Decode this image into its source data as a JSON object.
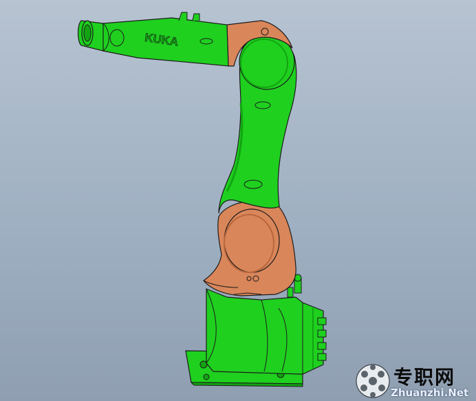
{
  "viewport": {
    "background_top": "#b7c3d1",
    "background_bottom": "#8f9fb1"
  },
  "model": {
    "brand_text": "KUKA",
    "colors": {
      "green": "#1fd01f",
      "green_dark": "#12a412",
      "orange": "#d9865a",
      "orange_dark": "#b8663d",
      "outline": "#1b1b1b"
    }
  },
  "watermark": {
    "chinese": "专职网",
    "url": "Zhuanzhi.Net",
    "icon": "soccer-ball-icon"
  }
}
